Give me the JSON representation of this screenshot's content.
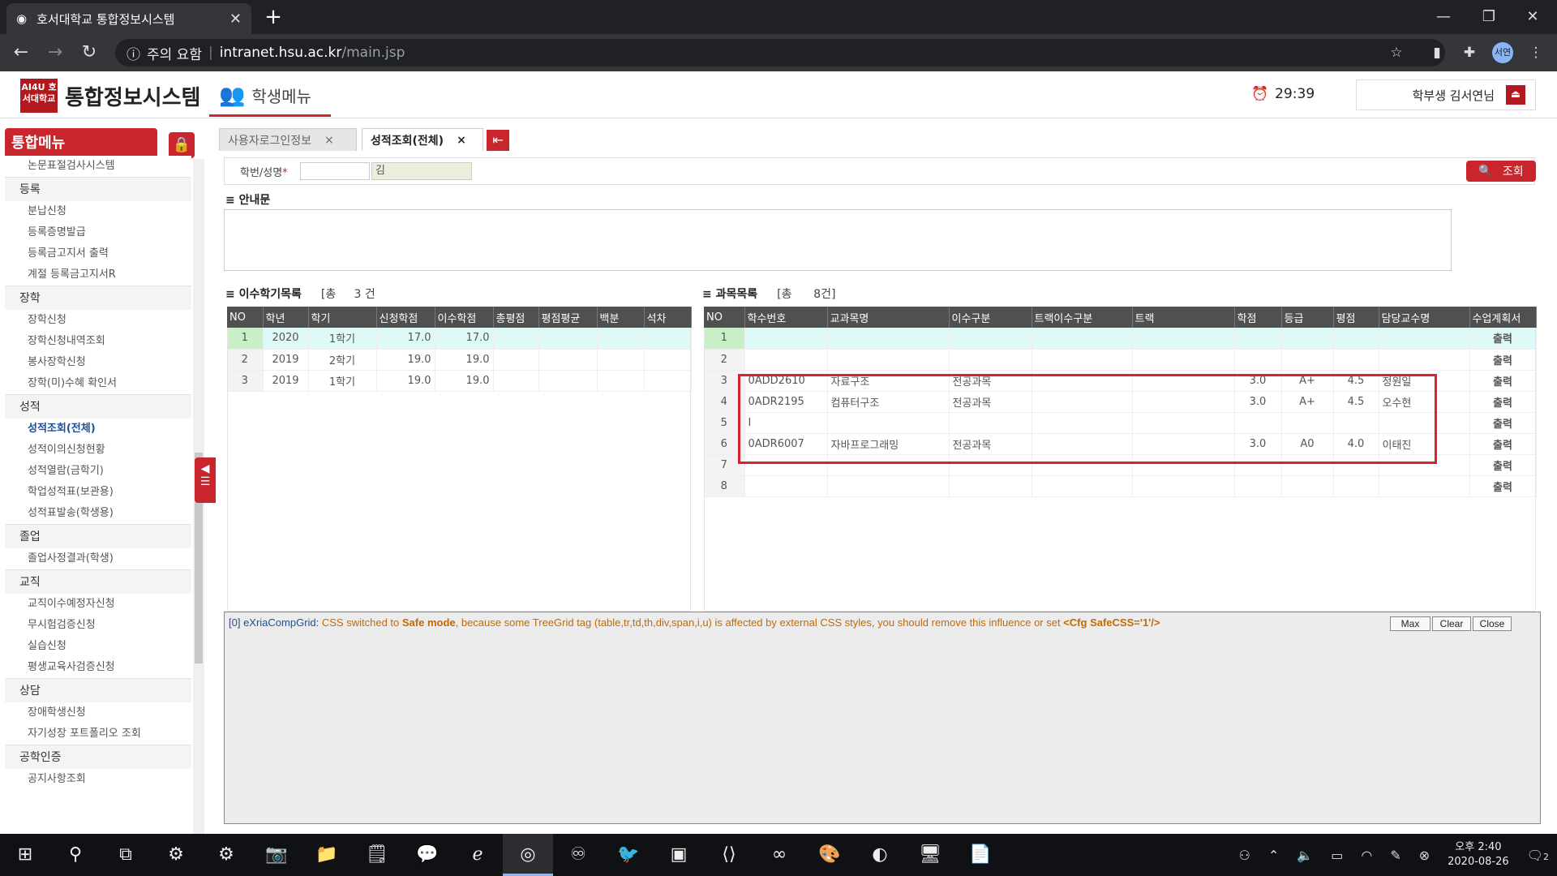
{
  "browser": {
    "tab_title": "호서대학교 통합정보시스템",
    "tab_close": "✕",
    "new_tab": "+",
    "security": "주의 요함",
    "url_host": "intranet.hsu.ac.kr",
    "url_path": "/main.jsp",
    "profile": "서연"
  },
  "app": {
    "logo_text": "AI4U 호서대학교",
    "title": "통합정보시스템",
    "student_menu": "학생메뉴",
    "timer": "29:39",
    "user": "학부생  김서연님"
  },
  "sidebar": {
    "header": "통합메뉴",
    "groups": [
      {
        "label": "",
        "items": [
          "논문표절검사시스템"
        ]
      },
      {
        "label": "등록",
        "items": [
          "분납신청",
          "등록증명발급",
          "등록금고지서 출력",
          "계절 등록금고지서R"
        ]
      },
      {
        "label": "장학",
        "items": [
          "장학신청",
          "장학신청내역조회",
          "봉사장학신청",
          "장학(미)수혜 확인서"
        ]
      },
      {
        "label": "성적",
        "items": [
          "성적조회(전체)",
          "성적이의신청현황",
          "성적열람(금학기)",
          "학업성적표(보관용)",
          "성적표발송(학생용)"
        ]
      },
      {
        "label": "졸업",
        "items": [
          "졸업사정결과(학생)"
        ]
      },
      {
        "label": "교직",
        "items": [
          "교직이수예정자신청",
          "무시험검증신청",
          "실습신청",
          "평생교육사검증신청"
        ]
      },
      {
        "label": "상담",
        "items": [
          "장애학생신청",
          "자기성장 포트폴리오 조회"
        ]
      },
      {
        "label": "공학인증",
        "items": [
          "공지사항조회"
        ]
      }
    ],
    "active_item": "성적조회(전체)"
  },
  "content_tabs": [
    {
      "label": "사용자로그인정보",
      "close": "×"
    },
    {
      "label": "성적조회(전체)",
      "close": "×"
    }
  ],
  "search": {
    "label": "학번/성명",
    "required_mark": "*",
    "name_value": "김",
    "button": "조회"
  },
  "notice": {
    "title": "안내문"
  },
  "semester_grid": {
    "title": "이수학기목록",
    "count_prefix": "[총",
    "count": "3",
    "count_suffix": "건",
    "columns": [
      "NO",
      "학년",
      "학기",
      "신청학점",
      "이수학점",
      "총평점",
      "평점평균",
      "백분",
      "석차"
    ],
    "rows": [
      [
        "1",
        "2020",
        "1학기",
        "17.0",
        "17.0",
        "",
        "",
        "",
        ""
      ],
      [
        "2",
        "2019",
        "2학기",
        "19.0",
        "19.0",
        "",
        "",
        "",
        ""
      ],
      [
        "3",
        "2019",
        "1학기",
        "19.0",
        "19.0",
        "",
        "",
        "",
        ""
      ]
    ]
  },
  "subject_grid": {
    "title": "과목목록",
    "count_prefix": "[총",
    "count": "8",
    "count_suffix": "건]",
    "columns": [
      "NO",
      "학수번호",
      "교과목명",
      "이수구분",
      "트랙이수구분",
      "트랙",
      "학점",
      "등급",
      "평점",
      "담당교수명",
      "수업계획서"
    ],
    "rows": [
      [
        "1",
        "",
        "",
        "",
        "",
        "",
        "",
        "",
        "",
        "",
        "출력"
      ],
      [
        "2",
        "",
        "",
        "",
        "",
        "",
        "",
        "",
        "",
        "",
        "출력"
      ],
      [
        "3",
        "0ADD2610",
        "자료구조",
        "전공과목",
        "",
        "",
        "3.0",
        "A+",
        "4.5",
        "정원일",
        "출력"
      ],
      [
        "4",
        "0ADR2195",
        "컴퓨터구조",
        "전공과목",
        "",
        "",
        "3.0",
        "A+",
        "4.5",
        "오수현",
        "출력"
      ],
      [
        "5",
        "I",
        "",
        "",
        "",
        "",
        "",
        "",
        "",
        "",
        "출력"
      ],
      [
        "6",
        "0ADR6007",
        "자바프로그래밍",
        "전공과목",
        "",
        "",
        "3.0",
        "A0",
        "4.0",
        "이태진",
        "출력"
      ],
      [
        "7",
        "",
        "",
        "",
        "",
        "",
        "",
        "",
        "",
        "",
        "출력"
      ],
      [
        "8",
        "",
        "",
        "",
        "",
        "",
        "",
        "",
        "",
        "",
        "출력"
      ]
    ]
  },
  "console": {
    "prefix": "[0] eXriaCompGrid:",
    "msg1": " CSS switched to ",
    "msg_bold1": "Safe mode",
    "msg2": ", because some TreeGrid tag (table,tr,td,th,div,span,i,u) is affected by external CSS styles, you should remove this influence or set ",
    "msg_bold2": "<Cfg SafeCSS='1'/>",
    "buttons": [
      "Max",
      "Clear",
      "Close"
    ]
  },
  "taskbar": {
    "time": "오후 2:40",
    "date": "2020-08-26",
    "notifications": "2"
  }
}
